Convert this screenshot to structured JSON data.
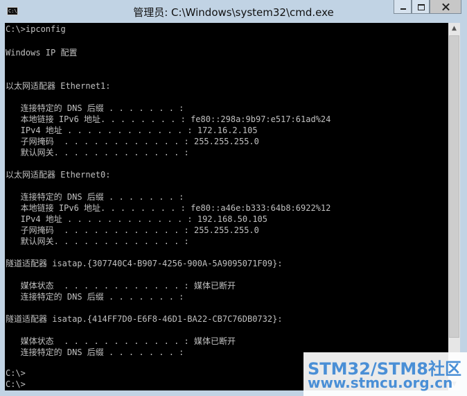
{
  "window": {
    "title": "管理员: C:\\Windows\\system32\\cmd.exe",
    "app_icon_text": "C:\\",
    "icon": "cmd-icon"
  },
  "console": {
    "lines": [
      "C:\\>ipconfig",
      "",
      "Windows IP 配置",
      "",
      "",
      "以太网适配器 Ethernet1:",
      "",
      "   连接特定的 DNS 后缀 . . . . . . . :",
      "   本地链接 IPv6 地址. . . . . . . . : fe80::298a:9b97:e517:61ad%24",
      "   IPv4 地址 . . . . . . . . . . . . : 172.16.2.105",
      "   子网掩码  . . . . . . . . . . . . : 255.255.255.0",
      "   默认网关. . . . . . . . . . . . . :",
      "",
      "以太网适配器 Ethernet0:",
      "",
      "   连接特定的 DNS 后缀 . . . . . . . :",
      "   本地链接 IPv6 地址. . . . . . . . : fe80::a46e:b333:64b8:6922%12",
      "   IPv4 地址 . . . . . . . . . . . . : 192.168.50.105",
      "   子网掩码  . . . . . . . . . . . . : 255.255.255.0",
      "   默认网关. . . . . . . . . . . . . :",
      "",
      "隧道适配器 isatap.{307740C4-B907-4256-900A-5A9095071F09}:",
      "",
      "   媒体状态  . . . . . . . . . . . . : 媒体已断开",
      "   连接特定的 DNS 后缀 . . . . . . . :",
      "",
      "隧道适配器 isatap.{414FF7D0-E6F8-46D1-BA22-CB7C76DB0732}:",
      "",
      "   媒体状态  . . . . . . . . . . . . : 媒体已断开",
      "   连接特定的 DNS 后缀 . . . . . . . :",
      "",
      "C:\\>",
      "C:\\>"
    ]
  },
  "watermark": {
    "line1": "STM32/STM8社区",
    "line2": "www.stmcu.org.cn"
  },
  "colors": {
    "console_bg": "#000000",
    "console_text": "#c0c0c0",
    "frame": "#c1d3e4",
    "watermark": "#4a8fd6"
  }
}
